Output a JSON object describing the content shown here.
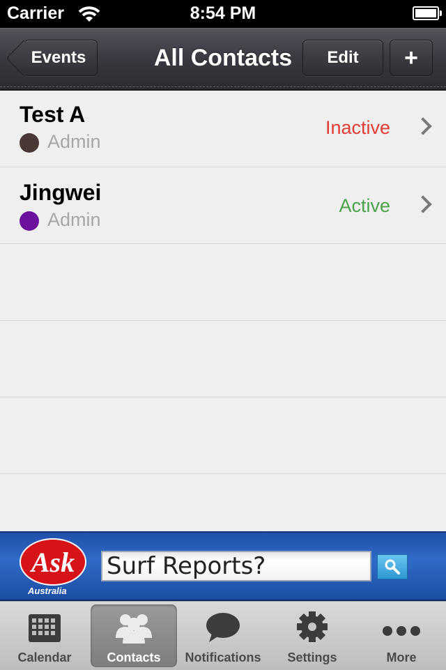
{
  "status_bar": {
    "carrier": "Carrier",
    "time": "8:54 PM"
  },
  "nav": {
    "back_label": "Events",
    "title": "All Contacts",
    "edit_label": "Edit",
    "add_label": "+"
  },
  "contacts": [
    {
      "name": "Test A",
      "role": "Admin",
      "status": "Inactive",
      "status_color": "#e03b35",
      "dot_color": "#4a3836"
    },
    {
      "name": "Jingwei",
      "role": "Admin",
      "status": "Active",
      "status_color": "#4aa34a",
      "dot_color": "#6c109e"
    }
  ],
  "ad": {
    "brand": "Ask",
    "sub": "Australia",
    "search_text": "Surf Reports?"
  },
  "tabs": [
    {
      "label": "Calendar",
      "icon": "calendar-icon"
    },
    {
      "label": "Contacts",
      "icon": "contacts-icon",
      "selected": true
    },
    {
      "label": "Notifications",
      "icon": "speech-bubble-icon"
    },
    {
      "label": "Settings",
      "icon": "gear-icon"
    },
    {
      "label": "More",
      "icon": "more-dots-icon"
    }
  ]
}
